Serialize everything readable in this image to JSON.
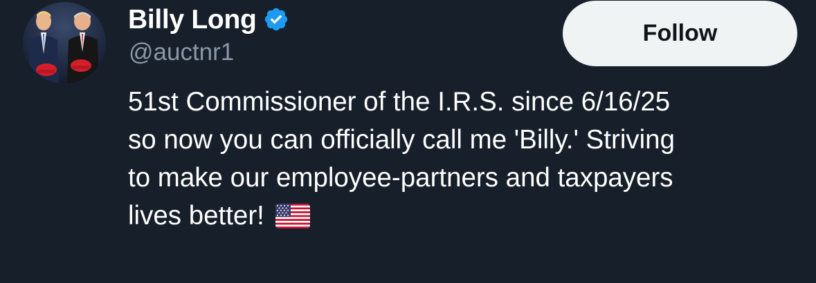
{
  "profile": {
    "display_name": "Billy Long",
    "handle": "@auctnr1",
    "verified": true,
    "verified_icon": "verified-badge-icon",
    "verified_color": "#1d9bf0",
    "avatar_icon": "profile-photo"
  },
  "follow_button": {
    "label": "Follow"
  },
  "bio": {
    "lines": [
      "51st Commissioner of the I.R.S. since 6/16/25",
      "so now you can officially call me 'Billy.' Striving",
      "to make our employee-partners and taxpayers",
      "lives better!"
    ],
    "emoji_icon": "us-flag-icon"
  },
  "colors": {
    "background": "#15202b",
    "text_primary": "#ffffff",
    "text_secondary": "#8b98a5",
    "button_bg": "#eff3f4",
    "button_text": "#0f1419"
  }
}
